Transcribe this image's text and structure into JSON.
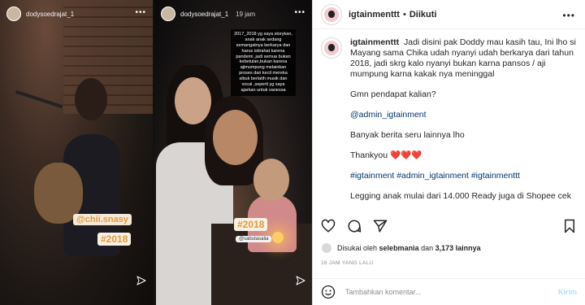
{
  "stories": [
    {
      "username": "dodysoedrajat_1",
      "time": "",
      "sticker_handle": "@chii.snasy",
      "sticker_year": "#2018"
    },
    {
      "username": "dodysoedrajat_1",
      "time": "19 jam",
      "overlay_text": "2017_2018 yg saya storykan, anak anak sedang semangatnya berkarya dan harus istirahat karena pandemi ,jadi semua bukan kebetulan,bukan karena ajimumpung melainkan proses dari kecil mereka sibuk berlatih musik dan vocal ,seperti yg saya ajarkan untuk vanessa",
      "sticker_year": "#2018",
      "sticker_small": "@sabutasalia"
    }
  ],
  "post": {
    "username": "igtainmenttt",
    "separator": "•",
    "follow_label": "Diikuti",
    "more_icon": "more-icon",
    "caption": {
      "intro": "Jadi disini pak Doddy mau kasih tau, Ini lho si Mayang sama Chika udah nyanyi udah berkarya dari tahun 2018, jadi skrg kalo nyanyi bukan karna pansos / aji mumpung karna kakak nya meninggal",
      "question": "Gmn pendapat kalian?",
      "mention": "@admin_igtainment",
      "more_news": "Banyak berita seru lainnya lho",
      "thanks": "Thankyou",
      "hearts": "❤️❤️❤️",
      "hashtags": "#igtainment #admin_igtainment #igtainmenttt",
      "promo": "Legging anak mulai dari 14.000 Ready juga di Shopee cek"
    },
    "likes": {
      "prefix": "Disukai oleh",
      "user": "selebmania",
      "connector": "dan",
      "count": "3,173 lainnya"
    },
    "posted_time": "16 JAM YANG LALU",
    "comment": {
      "placeholder": "Tambahkan komentar...",
      "post_label": "Kirim"
    },
    "colors": {
      "link": "#00376b",
      "muted": "#8e8e8e",
      "post_button": "#b2dffc",
      "sticker": "#e39a3c"
    }
  }
}
